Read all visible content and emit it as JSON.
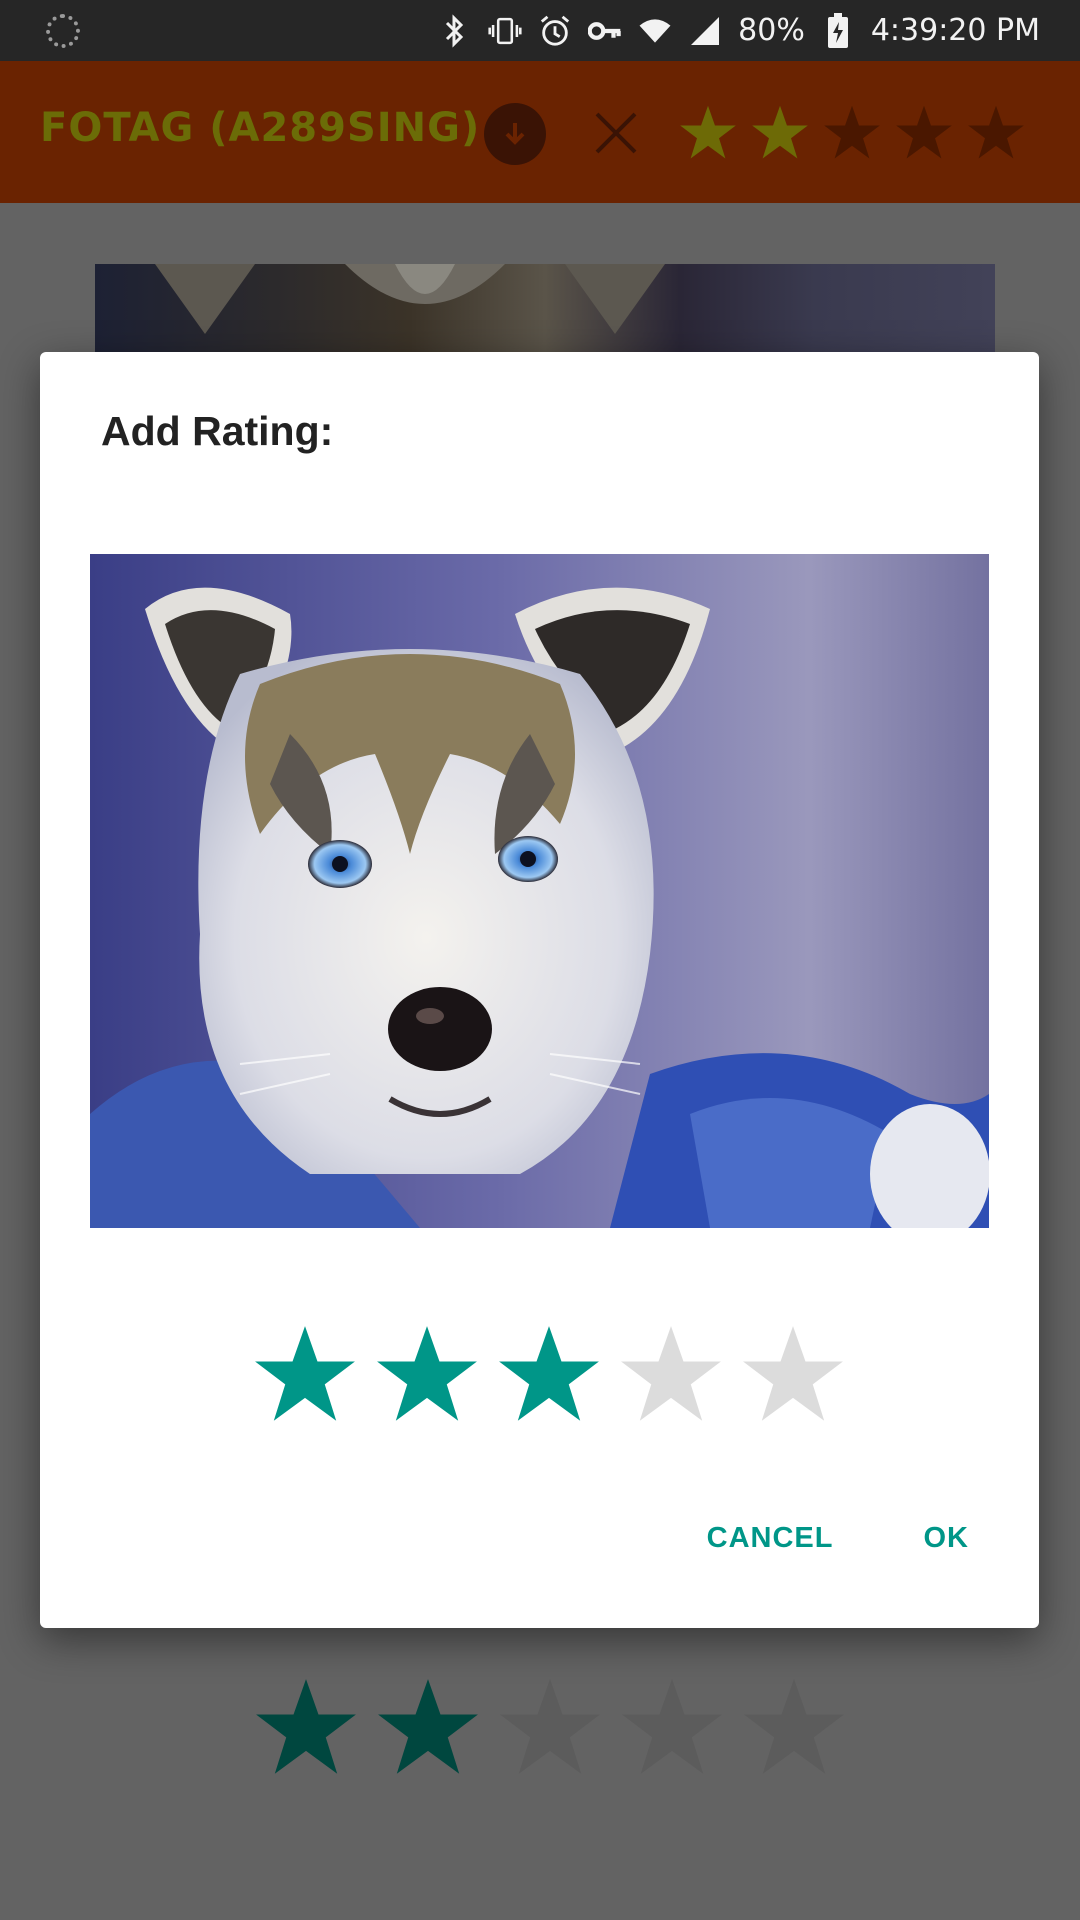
{
  "status_bar": {
    "battery": "80%",
    "time": "4:39:20 PM",
    "icons": [
      "loading-icon",
      "bluetooth-icon",
      "vibrate-icon",
      "alarm-icon",
      "vpn-key-icon",
      "wifi-icon",
      "cell-signal-icon",
      "battery-charging-icon"
    ]
  },
  "app_bar": {
    "title": "FOTAG (A289SING)",
    "download_icon": "download-icon",
    "clear_icon": "close-icon",
    "filter_rating": 2,
    "max_rating": 5
  },
  "background": {
    "card_rating": 2,
    "max_rating": 5
  },
  "dialog": {
    "title": "Add Rating:",
    "image_subject": "husky-puppy",
    "rating": 3,
    "max_rating": 5,
    "cancel_label": "CANCEL",
    "ok_label": "OK"
  },
  "colors": {
    "status_bar": "#262626",
    "app_bar_dimmed": "#6a2301",
    "title_dimmed": "#6b6c07",
    "star_filled_dialog": "#009688",
    "star_empty_dialog": "#dcdcdc",
    "star_filled_dimmed": "#00473f",
    "star_empty_dimmed": "#5c5c5c",
    "filter_star_filled": "#6d6a06",
    "filter_star_empty": "#4a1700",
    "scrim": "#636363",
    "accent": "#009688"
  }
}
